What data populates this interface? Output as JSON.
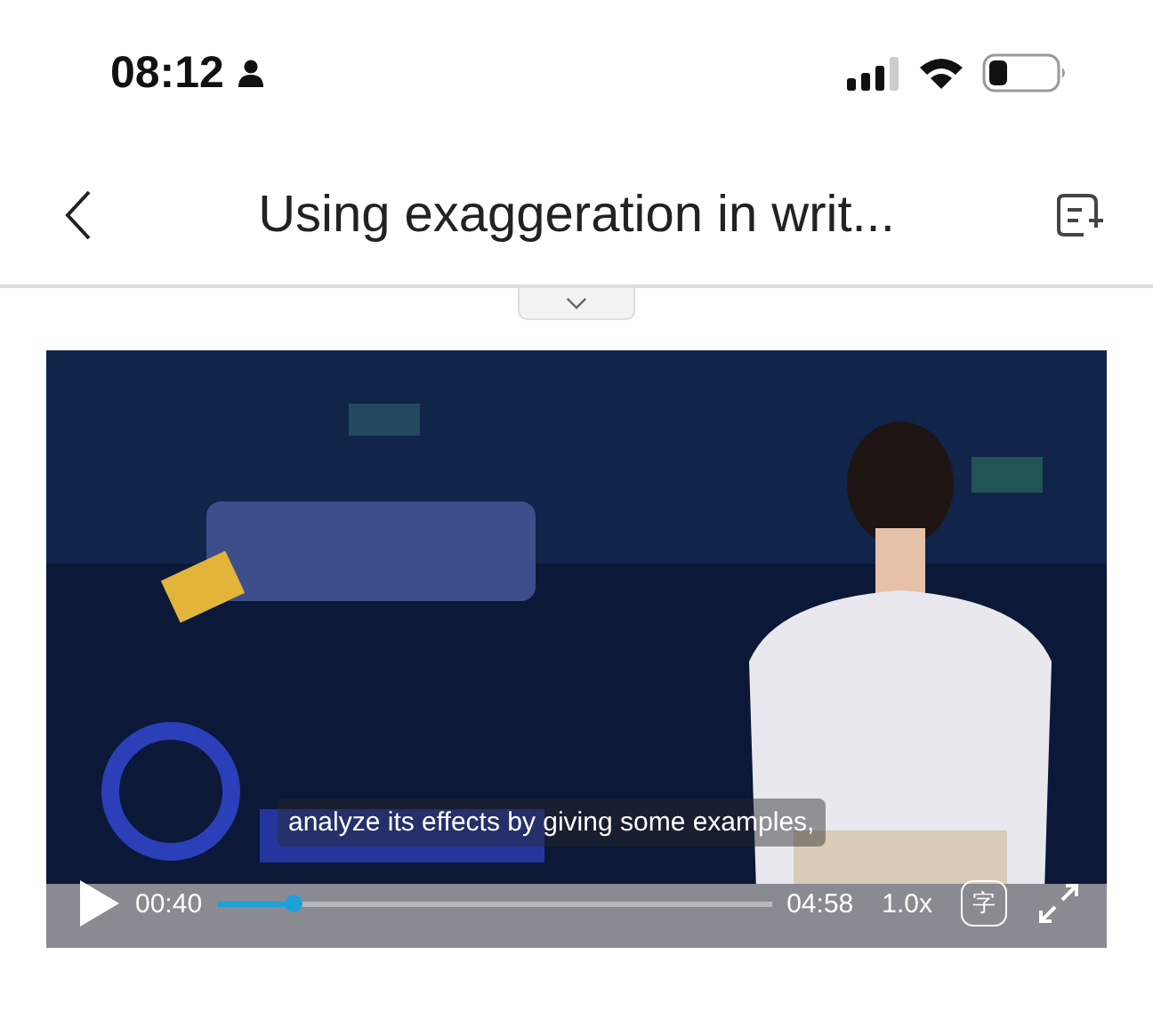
{
  "status_bar": {
    "time": "08:12"
  },
  "header": {
    "title": "Using exaggeration in writ..."
  },
  "video": {
    "kind": "picture",
    "subtitle": "analyze its effects by giving some examples,",
    "elapsed": "00:40",
    "duration": "04:58",
    "speed": "1.0x",
    "caption_key": "字",
    "level": 0.14
  }
}
